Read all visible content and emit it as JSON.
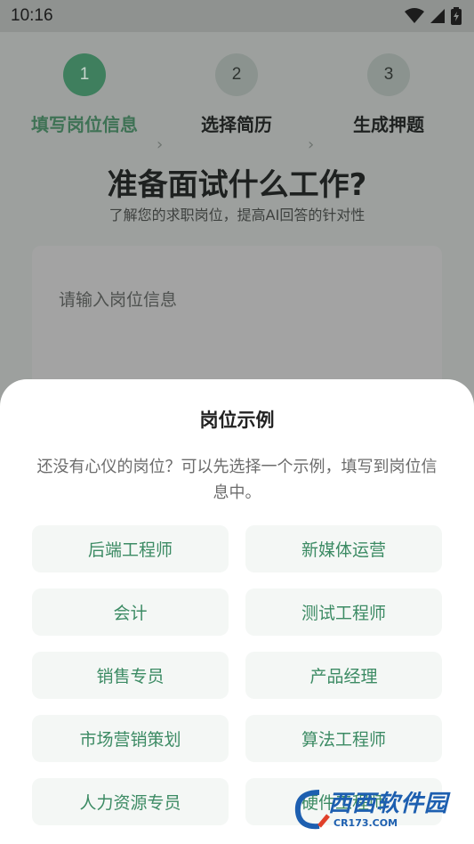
{
  "status_bar": {
    "time": "10:16",
    "icons": [
      "wifi-icon",
      "signal-icon",
      "battery-icon"
    ]
  },
  "stepper": {
    "steps": [
      {
        "number": "1",
        "label": "填写岗位信息",
        "state": "active"
      },
      {
        "number": "2",
        "label": "选择简历",
        "state": "inactive"
      },
      {
        "number": "3",
        "label": "生成押题",
        "state": "inactive"
      }
    ]
  },
  "header": {
    "title": "准备面试什么工作?",
    "subtitle": "了解您的求职岗位，提高AI回答的针对性"
  },
  "job_input": {
    "placeholder": "请输入岗位信息"
  },
  "sheet": {
    "title": "岗位示例",
    "description": "还没有心仪的岗位？可以先选择一个示例，填写到岗位信息中。",
    "examples": [
      "后端工程师",
      "新媒体运营",
      "会计",
      "测试工程师",
      "销售专员",
      "产品经理",
      "市场营销策划",
      "算法工程师",
      "人力资源专员",
      "硬件工程师"
    ]
  },
  "watermark": {
    "text": "西西软件园",
    "url_text": "CR173.COM"
  },
  "colors": {
    "accent": "#3c8b64",
    "chip_bg": "#f4f7f5",
    "overlay": "#9da09e"
  }
}
